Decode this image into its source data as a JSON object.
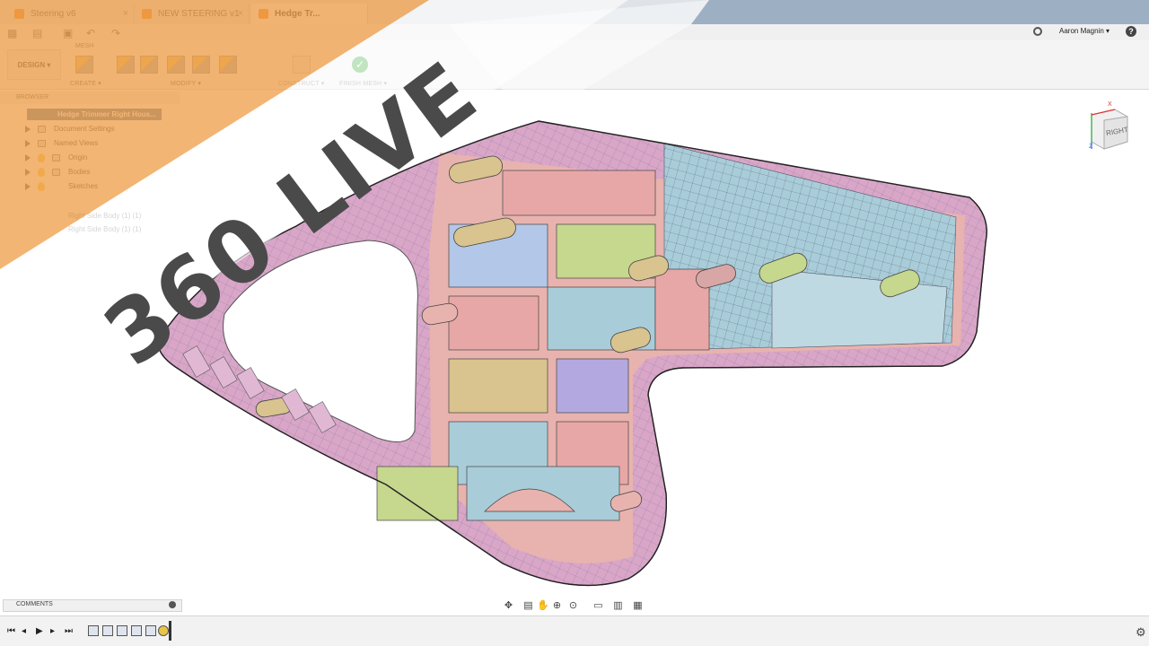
{
  "tabs": [
    {
      "label": "Steering v6",
      "active": false
    },
    {
      "label": "NEW STEERING v1",
      "active": false
    },
    {
      "label": "Hedge Tr...",
      "active": true
    }
  ],
  "ribbon": {
    "workspace_label": "DESIGN ▾",
    "section_label": "MESH",
    "groups": {
      "create": "CREATE ▾",
      "modify": "MODIFY ▾",
      "construct": "CONSTRUCT ▾",
      "finish": "FINISH MESH ▾"
    }
  },
  "user": {
    "name": "Aaron Magnin ▾",
    "help": "?"
  },
  "browser": {
    "header": "BROWSER",
    "root": "Hedge Trimmer Right Hous...",
    "items": [
      {
        "label": "Document Settings"
      },
      {
        "label": "Named Views"
      },
      {
        "label": "Origin"
      },
      {
        "label": "Bodies"
      },
      {
        "label": "Sketches"
      },
      {
        "label": "Right Side Body (1) (1)"
      },
      {
        "label": "Right Side Body (1) (1)"
      }
    ]
  },
  "banner": {
    "text": "360 LIVE"
  },
  "viewcube": {
    "face_label": "RIGHT",
    "axis_x": "X",
    "axis_z": "Z"
  },
  "comments": {
    "label": "COMMENTS"
  },
  "colors": {
    "banner_orange": "#f0a04b",
    "header_blue": "#4e6d93",
    "selected_row": "#4a6ea0",
    "mesh_pink": "#e8a7a7",
    "mesh_blue": "#a9ccd9",
    "mesh_green": "#c6d78e",
    "mesh_purple": "#b3a9e0"
  }
}
